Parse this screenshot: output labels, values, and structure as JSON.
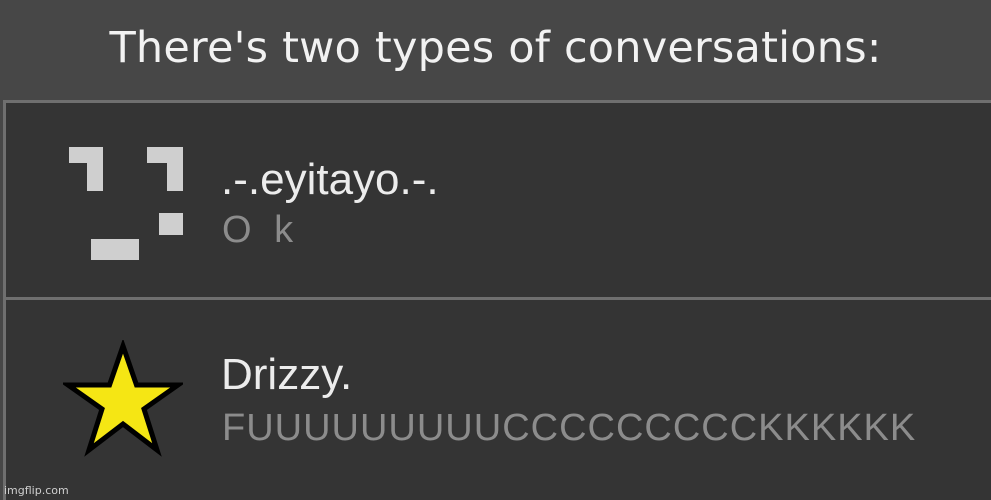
{
  "meme": {
    "title": "There's two types of conversations:"
  },
  "conversations": [
    {
      "name": ".-.eyitayo.-.",
      "preview": "O k",
      "avatar_icon": "pixel-face-icon",
      "avatar_color": "#cfcfcf"
    },
    {
      "name": "Drizzy.",
      "preview": "FUUUUUUUUUCCCCCCCCCKKKKKK",
      "avatar_icon": "star-icon",
      "avatar_color": "#f5e614"
    }
  ],
  "watermark": {
    "text": "imgflip.com"
  },
  "colors": {
    "background": "#474747",
    "list_background": "#343434",
    "divider": "#6f6f6f",
    "name_text": "#ececec",
    "preview_text": "#8c8c8c"
  }
}
